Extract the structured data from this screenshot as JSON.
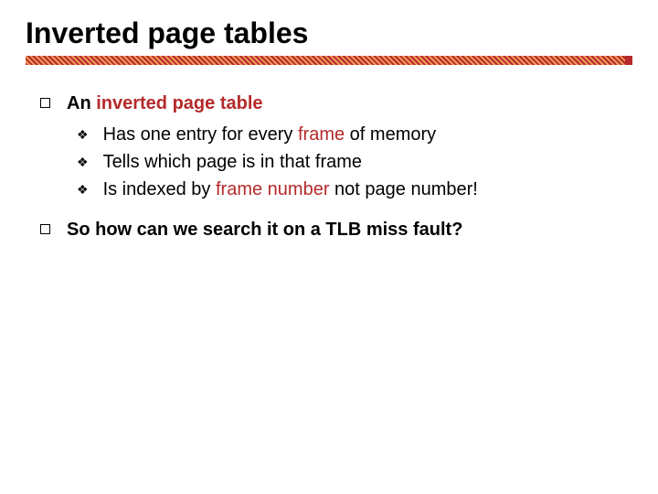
{
  "title": "Inverted page tables",
  "b1": {
    "lead_pre": "An ",
    "lead_hl": "inverted page table",
    "sub1_pre": "Has one entry for every ",
    "sub1_hl": "frame",
    "sub1_post": " of memory",
    "sub2": "Tells which page is in that frame",
    "sub3_pre": "Is indexed by ",
    "sub3_hl": "frame number",
    "sub3_post": " not page number!"
  },
  "b2": {
    "text": "So how can we search it on a TLB miss fault?"
  }
}
